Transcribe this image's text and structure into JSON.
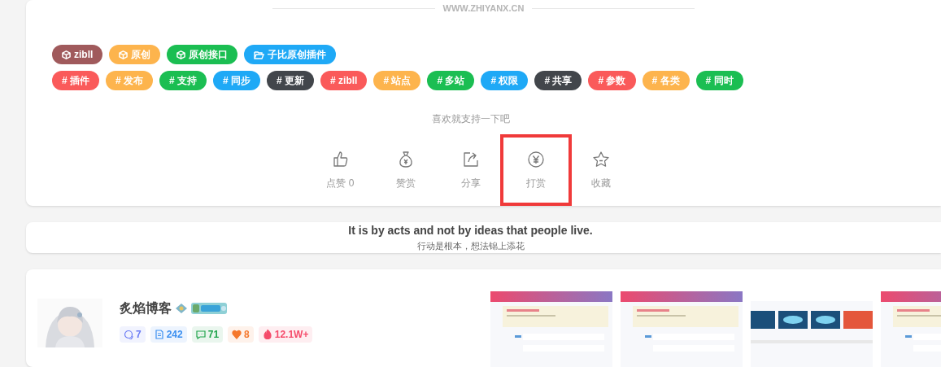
{
  "divider_text": "WWW.ZHIYANX.CN",
  "category_tags": [
    {
      "label": "zibll",
      "color": "#a05a5c"
    },
    {
      "label": "原创",
      "color": "#fdb44d"
    },
    {
      "label": "原创接口",
      "color": "#1bbe52"
    },
    {
      "label": "子比原创插件",
      "color": "#1fa9f6"
    }
  ],
  "topic_tags": [
    {
      "label": "# 插件",
      "color": "#fa5a5a"
    },
    {
      "label": "# 发布",
      "color": "#fdb44d"
    },
    {
      "label": "# 支持",
      "color": "#1bbe52"
    },
    {
      "label": "# 同步",
      "color": "#1fa9f6"
    },
    {
      "label": "# 更新",
      "color": "#42464b"
    },
    {
      "label": "# zibll",
      "color": "#fa5a5a"
    },
    {
      "label": "# 站点",
      "color": "#fdb44d"
    },
    {
      "label": "# 多站",
      "color": "#1bbe52"
    },
    {
      "label": "# 权限",
      "color": "#1fa9f6"
    },
    {
      "label": "# 共享",
      "color": "#42464b"
    },
    {
      "label": "# 参数",
      "color": "#fa5a5a"
    },
    {
      "label": "# 各类",
      "color": "#fdb44d"
    },
    {
      "label": "# 同时",
      "color": "#1bbe52"
    }
  ],
  "support_prompt": "喜欢就支持一下吧",
  "actions": [
    {
      "label": "点赞 0",
      "highlighted": false
    },
    {
      "label": "赞赏",
      "highlighted": false
    },
    {
      "label": "分享",
      "highlighted": false
    },
    {
      "label": "打赏",
      "highlighted": true
    },
    {
      "label": "收藏",
      "highlighted": false
    }
  ],
  "quote": {
    "text": "It is by acts and not by ideas that people live.",
    "translation": "行动是根本，想法锦上添花"
  },
  "author": {
    "name": "炙焰博客",
    "stats": [
      {
        "value": "7",
        "color": "#6b7cf5"
      },
      {
        "value": "242",
        "color": "#3b8ff0"
      },
      {
        "value": "71",
        "color": "#1fa34a"
      },
      {
        "value": "8",
        "color": "#f5782d"
      },
      {
        "value": "12.1W+",
        "color": "#f54a6a"
      }
    ]
  }
}
